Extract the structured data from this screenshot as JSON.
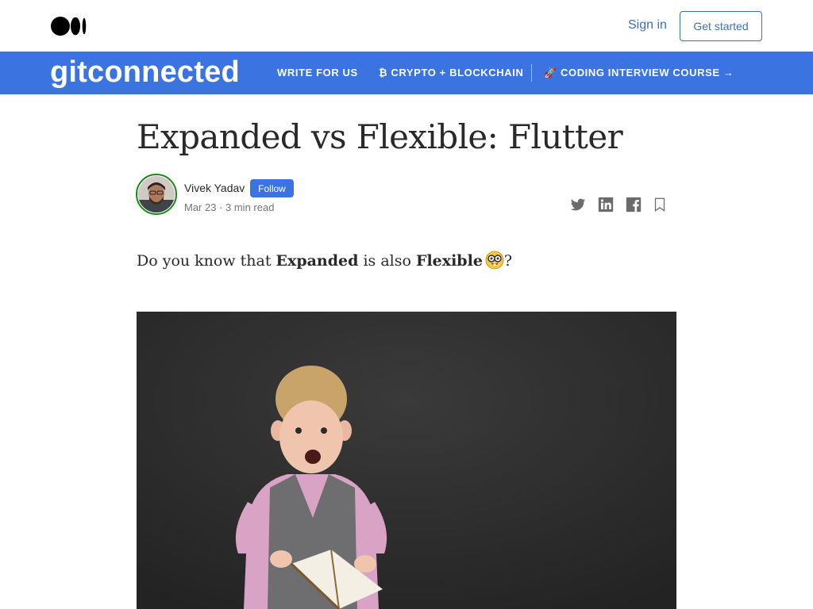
{
  "header": {
    "signin_label": "Sign in",
    "getstarted_label": "Get started"
  },
  "publication": {
    "logo_text": "gitconnected",
    "brand_color": "#3b73e0",
    "nav": [
      {
        "label": "WRITE FOR US"
      },
      {
        "label": "₿ CRYPTO + BLOCKCHAIN"
      },
      {
        "label": "🚀 CODING INTERVIEW COURSE →"
      }
    ]
  },
  "article": {
    "title": "Expanded vs Flexible: Flutter",
    "author": {
      "name": "Vivek Yadav",
      "follow_label": "Follow"
    },
    "meta": "Mar 23 · 3 min read",
    "lead": {
      "prefix": "Do you know that ",
      "bold1": "Expanded",
      "middle": " is also ",
      "bold2": "Flexible",
      "emoji_icon": "nerd-face-emoji-icon",
      "suffix": "?"
    }
  },
  "share_icons": [
    "twitter-icon",
    "linkedin-icon",
    "facebook-icon",
    "bookmark-icon"
  ]
}
